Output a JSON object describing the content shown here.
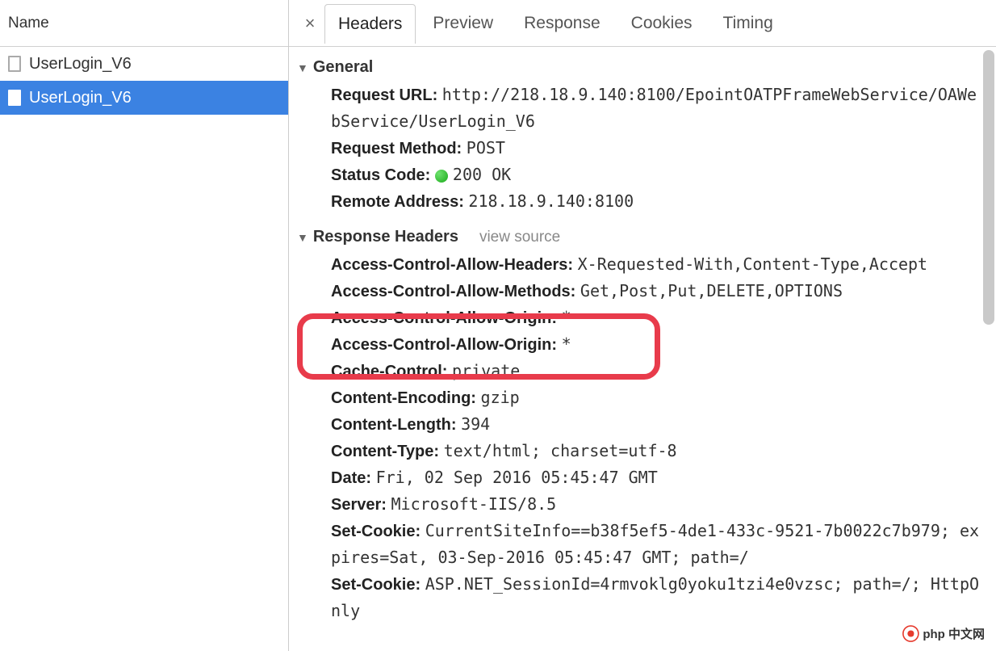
{
  "leftPane": {
    "header": "Name",
    "items": [
      {
        "label": "UserLogin_V6",
        "selected": false
      },
      {
        "label": "UserLogin_V6",
        "selected": true
      }
    ]
  },
  "tabs": {
    "items": [
      "Headers",
      "Preview",
      "Response",
      "Cookies",
      "Timing"
    ],
    "activeIndex": 0
  },
  "sections": {
    "general": {
      "title": "General",
      "rows": [
        {
          "k": "Request URL:",
          "v": "http://218.18.9.140:8100/EpointOATPFrameWebService/OAWebService/UserLogin_V6"
        },
        {
          "k": "Request Method:",
          "v": "POST"
        },
        {
          "k": "Status Code:",
          "v": "200 OK",
          "status": true
        },
        {
          "k": "Remote Address:",
          "v": "218.18.9.140:8100"
        }
      ]
    },
    "responseHeaders": {
      "title": "Response Headers",
      "viewSource": "view source",
      "rows": [
        {
          "k": "Access-Control-Allow-Headers:",
          "v": "X-Requested-With,Content-Type,Accept"
        },
        {
          "k": "Access-Control-Allow-Methods:",
          "v": "Get,Post,Put,DELETE,OPTIONS"
        },
        {
          "k": "Access-Control-Allow-Origin:",
          "v": "*"
        },
        {
          "k": "Access-Control-Allow-Origin:",
          "v": "*"
        },
        {
          "k": "Cache-Control:",
          "v": "private"
        },
        {
          "k": "Content-Encoding:",
          "v": "gzip"
        },
        {
          "k": "Content-Length:",
          "v": "394"
        },
        {
          "k": "Content-Type:",
          "v": "text/html; charset=utf-8"
        },
        {
          "k": "Date:",
          "v": "Fri, 02 Sep 2016 05:45:47 GMT"
        },
        {
          "k": "Server:",
          "v": "Microsoft-IIS/8.5"
        },
        {
          "k": "Set-Cookie:",
          "v": "CurrentSiteInfo==b38f5ef5-4de1-433c-9521-7b0022c7b979; expires=Sat, 03-Sep-2016 05:45:47 GMT; path=/"
        },
        {
          "k": "Set-Cookie:",
          "v": "ASP.NET_SessionId=4rmvoklg0yoku1tzi4e0vzsc; path=/; HttpOnly"
        }
      ]
    }
  },
  "watermark": "php 中文网"
}
